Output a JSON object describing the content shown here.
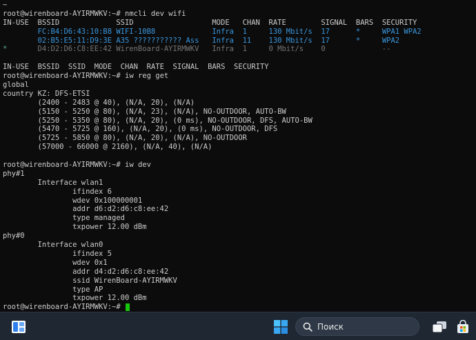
{
  "terminal": {
    "lines": [
      [
        {
          "text": "~",
          "col": 0
        }
      ],
      [
        {
          "text": "root@wirenboard-AYIRMWKV:~# nmcli dev wifi",
          "col": 0
        }
      ],
      [
        {
          "text": "IN-USE",
          "col": 0
        },
        {
          "text": "BSSID",
          "col": 8
        },
        {
          "text": "SSID",
          "col": 26
        },
        {
          "text": "MODE",
          "col": 48
        },
        {
          "text": "CHAN",
          "col": 55
        },
        {
          "text": "RATE",
          "col": 61
        },
        {
          "text": "SIGNAL",
          "col": 73
        },
        {
          "text": "BARS",
          "col": 81
        },
        {
          "text": "SECURITY",
          "col": 87
        }
      ],
      [
        {
          "text": "FC:B4:D6:43:10:B8",
          "col": 8,
          "cls": "cyan"
        },
        {
          "text": "WIFI-10B8",
          "col": 26,
          "cls": "cyan"
        },
        {
          "text": "Infra",
          "col": 48,
          "cls": "cyan"
        },
        {
          "text": "1",
          "col": 55,
          "cls": "cyan"
        },
        {
          "text": "130 Mbit/s",
          "col": 61,
          "cls": "cyan"
        },
        {
          "text": "17",
          "col": 73,
          "cls": "cyan"
        },
        {
          "text": "*",
          "col": 81,
          "cls": "cyan"
        },
        {
          "text": "WPA1 WPA2",
          "col": 87,
          "cls": "cyan"
        }
      ],
      [
        {
          "text": "02:B5:E5:11:D9:3E",
          "col": 8,
          "cls": "cyan"
        },
        {
          "text": "A35 ??????????? Ass",
          "col": 26,
          "cls": "cyan"
        },
        {
          "text": "Infra",
          "col": 48,
          "cls": "cyan"
        },
        {
          "text": "11",
          "col": 55,
          "cls": "cyan"
        },
        {
          "text": "130 Mbit/s",
          "col": 61,
          "cls": "cyan"
        },
        {
          "text": "17",
          "col": 73,
          "cls": "cyan"
        },
        {
          "text": "*",
          "col": 81,
          "cls": "cyan"
        },
        {
          "text": "WPA2",
          "col": 87,
          "cls": "cyan"
        }
      ],
      [
        {
          "text": "*",
          "col": 0,
          "cls": "green-dim"
        },
        {
          "text": "D4:D2:D6:C8:EE:42",
          "col": 8,
          "cls": "dim"
        },
        {
          "text": "WirenBoard-AYIRMWKV",
          "col": 26,
          "cls": "dim"
        },
        {
          "text": "Infra",
          "col": 48,
          "cls": "dim"
        },
        {
          "text": "1",
          "col": 55,
          "cls": "dim"
        },
        {
          "text": "0 Mbit/s",
          "col": 61,
          "cls": "dim"
        },
        {
          "text": "0",
          "col": 73,
          "cls": "dim"
        },
        {
          "text": "--",
          "col": 87,
          "cls": "dim"
        }
      ],
      [],
      [
        {
          "text": "IN-USE  BSSID  SSID  MODE  CHAN  RATE  SIGNAL  BARS  SECURITY",
          "col": 0
        }
      ],
      [
        {
          "text": "root@wirenboard-AYIRMWKV:~# iw reg get",
          "col": 0
        }
      ],
      [
        {
          "text": "global",
          "col": 0
        }
      ],
      [
        {
          "text": "country KZ: DFS-ETSI",
          "col": 0
        }
      ],
      [
        {
          "text": "(2400 - 2483 @ 40), (N/A, 20), (N/A)",
          "col": 8
        }
      ],
      [
        {
          "text": "(5150 - 5250 @ 80), (N/A, 23), (N/A), NO-OUTDOOR, AUTO-BW",
          "col": 8
        }
      ],
      [
        {
          "text": "(5250 - 5350 @ 80), (N/A, 20), (0 ms), NO-OUTDOOR, DFS, AUTO-BW",
          "col": 8
        }
      ],
      [
        {
          "text": "(5470 - 5725 @ 160), (N/A, 20), (0 ms), NO-OUTDOOR, DFS",
          "col": 8
        }
      ],
      [
        {
          "text": "(5725 - 5850 @ 80), (N/A, 20), (N/A), NO-OUTDOOR",
          "col": 8
        }
      ],
      [
        {
          "text": "(57000 - 66000 @ 2160), (N/A, 40), (N/A)",
          "col": 8
        }
      ],
      [],
      [
        {
          "text": "root@wirenboard-AYIRMWKV:~# iw dev",
          "col": 0
        }
      ],
      [
        {
          "text": "phy#1",
          "col": 0
        }
      ],
      [
        {
          "text": "Interface wlan1",
          "col": 8
        }
      ],
      [
        {
          "text": "ifindex 6",
          "col": 16
        }
      ],
      [
        {
          "text": "wdev 0x100000001",
          "col": 16
        }
      ],
      [
        {
          "text": "addr d6:d2:d6:c8:ee:42",
          "col": 16
        }
      ],
      [
        {
          "text": "type managed",
          "col": 16
        }
      ],
      [
        {
          "text": "txpower 12.00 dBm",
          "col": 16
        }
      ],
      [
        {
          "text": "phy#0",
          "col": 0
        }
      ],
      [
        {
          "text": "Interface wlan0",
          "col": 8
        }
      ],
      [
        {
          "text": "ifindex 5",
          "col": 16
        }
      ],
      [
        {
          "text": "wdev 0x1",
          "col": 16
        }
      ],
      [
        {
          "text": "addr d4:d2:d6:c8:ee:42",
          "col": 16
        }
      ],
      [
        {
          "text": "ssid WirenBoard-AYIRMWKV",
          "col": 16
        }
      ],
      [
        {
          "text": "type AP",
          "col": 16
        }
      ],
      [
        {
          "text": "txpower 12.00 dBm",
          "col": 16
        }
      ],
      [
        {
          "text": "root@wirenboard-AYIRMWKV:~# ",
          "col": 0
        }
      ]
    ],
    "colors": {
      "background": "#0c0c0c",
      "foreground": "#cccccc",
      "highlight": "#3a96dd",
      "dim": "#767676",
      "cursor": "#16c60c"
    }
  },
  "taskbar": {
    "search_label": "Поиск",
    "icons": {
      "snap": "snap-layout-icon",
      "start": "windows-start-icon",
      "search": "search-icon",
      "task_view": "task-view-icon",
      "store": "store-icon"
    },
    "colors": {
      "background": "#1f2733",
      "start_blue": "#4cc2ff"
    }
  }
}
